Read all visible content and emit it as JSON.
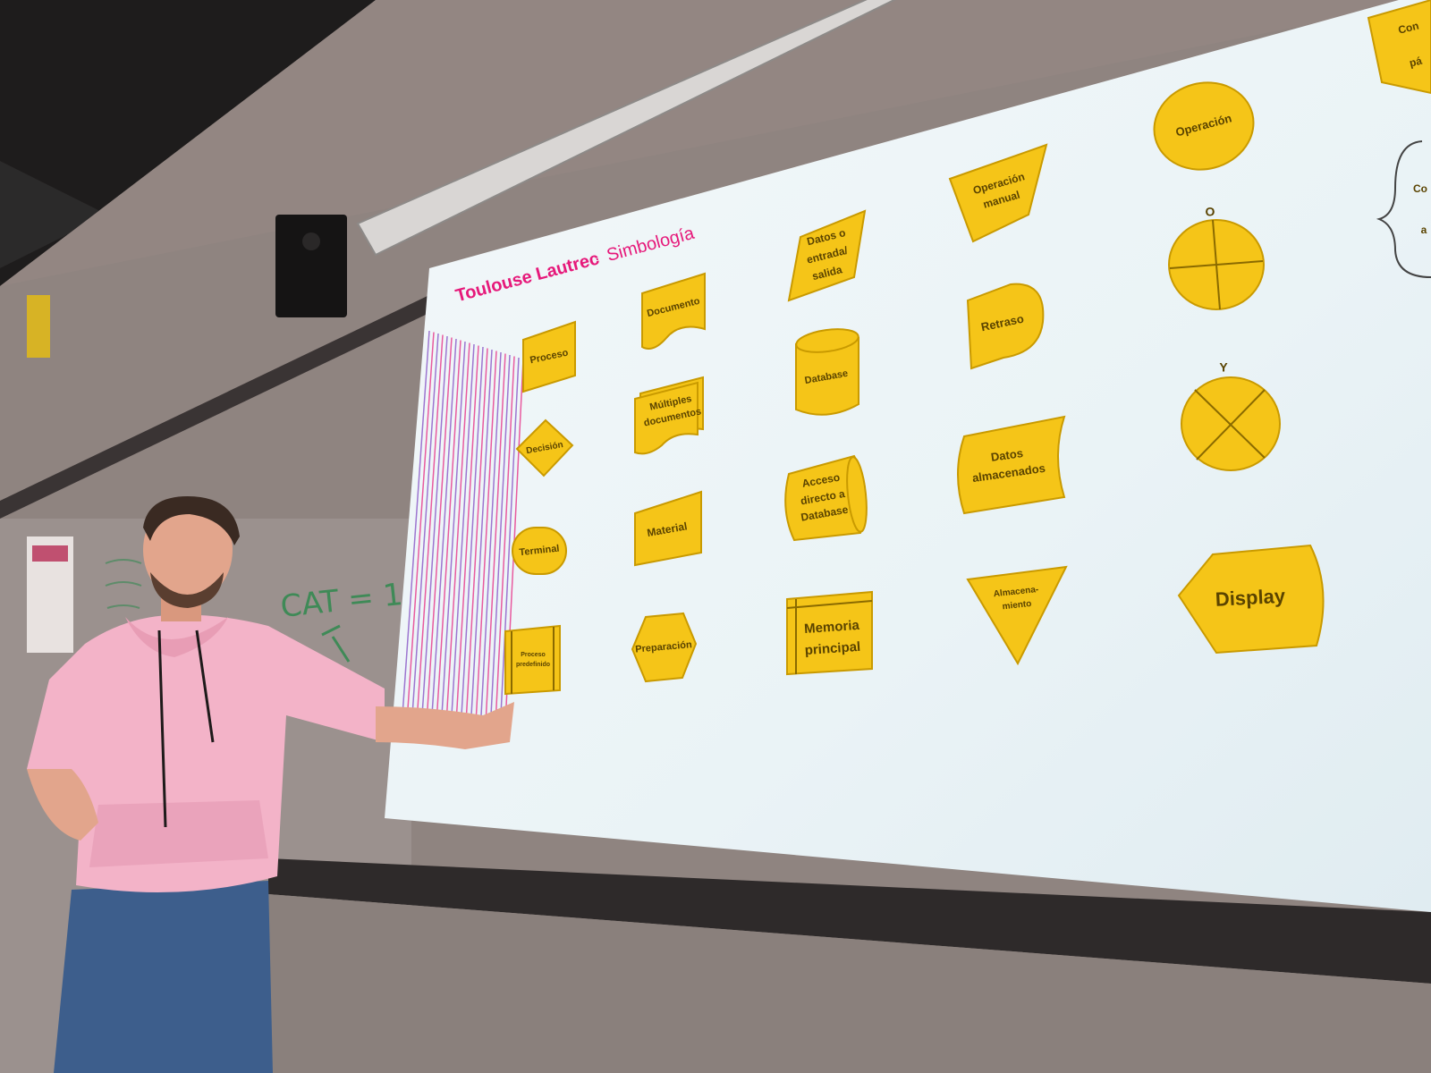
{
  "slide": {
    "brand": "Toulouse Lautrec",
    "separator": "·",
    "title": "Simbología"
  },
  "symbols": {
    "proceso": "Proceso",
    "decision": "Decisión",
    "terminal": "Terminal",
    "proceso_predefinido_1": "Proceso",
    "proceso_predefinido_2": "predefinido",
    "documento": "Documento",
    "multiples_1": "Múltiples",
    "multiples_2": "documentos",
    "material": "Material",
    "preparacion": "Preparación",
    "datos_es_1": "Datos o",
    "datos_es_2": "entrada/",
    "datos_es_3": "salida",
    "database": "Database",
    "acceso_1": "Acceso",
    "acceso_2": "directo a",
    "acceso_3": "Database",
    "memoria_1": "Memoria",
    "memoria_2": "principal",
    "op_manual_1": "Operación",
    "op_manual_2": "manual",
    "retraso": "Retraso",
    "datos_alm_1": "Datos",
    "datos_alm_2": "almacenados",
    "almacen_1": "Almacena-",
    "almacen_2": "miento",
    "operacion": "Operación",
    "o_label": "O",
    "y_label": "Y",
    "display": "Display",
    "cut_1": "Con",
    "cut_2": "pá",
    "cut_3": "Co",
    "cut_4": "a"
  },
  "whiteboard": {
    "formula": "CAT = 1"
  },
  "colors": {
    "symbol_fill": "#f5c518",
    "brand_pink": "#e6197a",
    "screen": "#eef5f8",
    "hoodie": "#f3b3c8",
    "jeans": "#3d5e8c"
  }
}
